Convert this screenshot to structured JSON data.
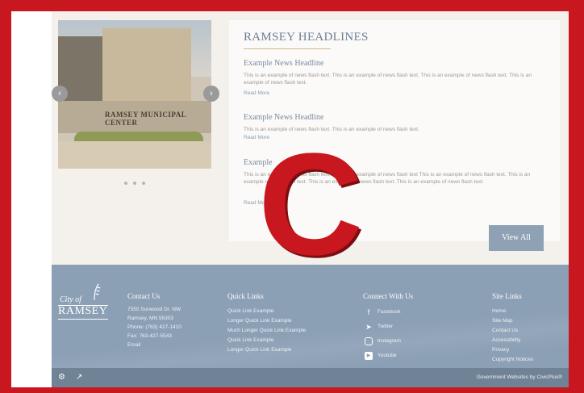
{
  "slider": {
    "sign_text": "RAMSEY MUNICIPAL CENTER",
    "prev_icon": "chevron-left-icon",
    "next_icon": "chevron-right-icon",
    "dot_count": 3
  },
  "news": {
    "title": "RAMSEY HEADLINES",
    "items": [
      {
        "headline": "Example News Headline",
        "text": "This is an example of news flash text. This is an example of news flash text. This is an example of news flash text. This is an example of news flash text.",
        "read_more": "Read More"
      },
      {
        "headline": "Example News Headline",
        "text": "This is an example of news flash text. This is an example of news flash text.",
        "read_more": "Read More"
      },
      {
        "headline": "Example",
        "text": "This is an example of news flash text. This is an example of news flash text This is an example of news flash text. This is an example of news flash text. This is an example of news flash text. This is an example of news flash text.",
        "read_more": "Read More"
      }
    ],
    "view_all": "View All"
  },
  "footer": {
    "logo": {
      "top": "City of",
      "main": "RAMSEY"
    },
    "contact": {
      "title": "Contact Us",
      "lines": [
        "7550 Sunwood Dr. NW",
        "Ramsey, MN 55303",
        "Phone: (763) 427-1410",
        "Fax: 763-427-5543",
        "Email"
      ]
    },
    "quick_links": {
      "title": "Quick Links",
      "links": [
        "Quick Link Example",
        "Longer Quick Link Example",
        "Much Longer Quick Link Example",
        "Quick Link Example",
        "Longer Quick Link Example"
      ]
    },
    "connect": {
      "title": "Connect With Us",
      "items": [
        {
          "label": "Facebook",
          "icon": "facebook-icon"
        },
        {
          "label": "Twitter",
          "icon": "twitter-icon"
        },
        {
          "label": "Instagram",
          "icon": "instagram-icon"
        },
        {
          "label": "Youtube",
          "icon": "youtube-icon"
        }
      ]
    },
    "site_links": {
      "title": "Site Links",
      "links": [
        "Home",
        "Site Map",
        "Contact Us",
        "Accessibility",
        "Privacy",
        "Copyright Notices"
      ]
    }
  },
  "bottom_bar": {
    "credit": "Government Websites by CivicPlus®",
    "icons": [
      "gear-icon",
      "share-icon"
    ]
  },
  "overlay": {
    "letter": "C"
  },
  "colors": {
    "frame": "#c8171e",
    "footer": "#8b9fb5",
    "bottom_bar": "#6f8296",
    "headline": "#6b7f97",
    "button": "#8fa1b4"
  }
}
